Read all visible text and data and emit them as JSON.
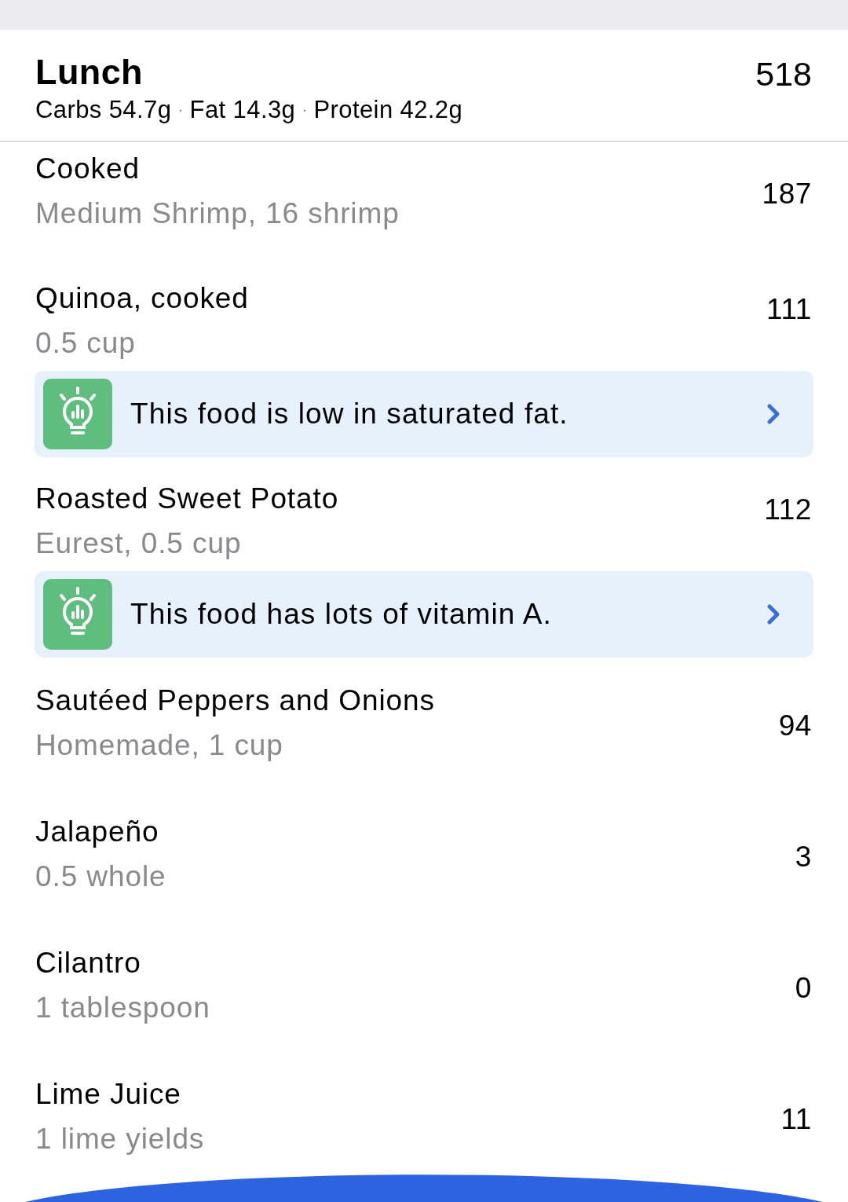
{
  "meal": {
    "title": "Lunch",
    "calories": "518",
    "macros": [
      "Carbs 54.7g",
      "Fat 14.3g",
      "Protein 42.2g"
    ],
    "separators": [
      "·",
      "·"
    ]
  },
  "foods": [
    {
      "name": "Cooked",
      "detail": "Medium Shrimp, 16 shrimp",
      "calories": "187"
    },
    {
      "name": "Quinoa, cooked",
      "detail": "0.5 cup",
      "calories": "111",
      "tip": {
        "text": "This food is low in saturated fat."
      }
    },
    {
      "name": "Roasted Sweet Potato",
      "detail": "Eurest, 0.5 cup",
      "calories": "112",
      "tip": {
        "text": "This food has lots of vitamin A."
      }
    },
    {
      "name": "Sautéed Peppers and Onions",
      "detail": "Homemade, 1 cup",
      "calories": "94"
    },
    {
      "name": "Jalapeño",
      "detail": "0.5 whole",
      "calories": "3"
    },
    {
      "name": "Cilantro",
      "detail": "1 tablespoon",
      "calories": "0"
    },
    {
      "name": "Lime Juice",
      "detail": "1 lime yields",
      "calories": "11"
    }
  ]
}
